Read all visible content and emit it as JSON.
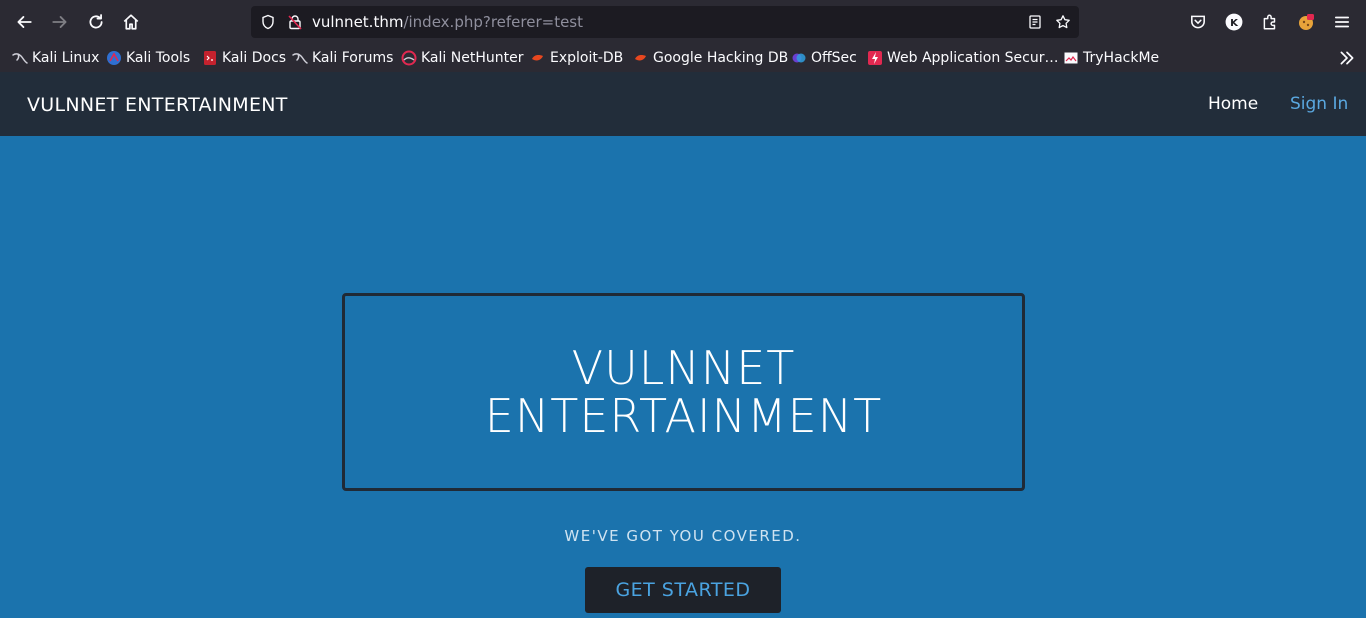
{
  "browser": {
    "url_host": "vulnnet.thm",
    "url_path": "/index.php?referer=test",
    "bookmarks": [
      {
        "label": "Kali Linux",
        "icon": "kali-dragon-icon"
      },
      {
        "label": "Kali Tools",
        "icon": "kali-tools-icon"
      },
      {
        "label": "Kali Docs",
        "icon": "kali-docs-icon"
      },
      {
        "label": "Kali Forums",
        "icon": "kali-dragon-icon"
      },
      {
        "label": "Kali NetHunter",
        "icon": "nethunter-icon"
      },
      {
        "label": "Exploit-DB",
        "icon": "exploitdb-icon"
      },
      {
        "label": "Google Hacking DB",
        "icon": "exploitdb-icon"
      },
      {
        "label": "OffSec",
        "icon": "offsec-icon"
      },
      {
        "label": "Web Application Secur…",
        "icon": "bolt-icon"
      },
      {
        "label": "TryHackMe",
        "icon": "broken-image-icon"
      }
    ]
  },
  "site": {
    "brand": "VULNNET ENTERTAINMENT",
    "nav": {
      "home": "Home",
      "signin": "Sign In"
    },
    "hero": {
      "title_line1": "VULNNET",
      "title_line2": "ENTERTAINMENT",
      "tagline": "WE'VE GOT YOU COVERED.",
      "cta": "GET STARTED"
    }
  },
  "colors": {
    "chrome": "#2b2a33",
    "urlbar": "#1c1b22",
    "navbar": "#222d3a",
    "hero_bg": "#1b73ad",
    "accent": "#4aa3e0"
  }
}
